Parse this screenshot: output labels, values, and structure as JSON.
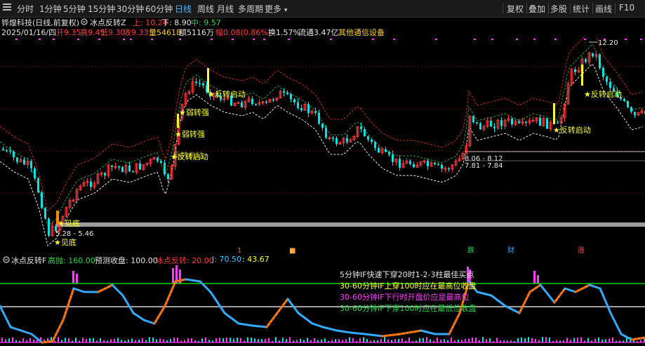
{
  "toolbar": {
    "left_items": [
      "分时",
      "1分钟",
      "5分钟",
      "15分钟",
      "30分钟",
      "60分钟",
      "日线",
      "周线",
      "月线",
      "多周期",
      "更多"
    ],
    "active_item": "日线",
    "right_items": [
      "复权",
      "叠加",
      "多股",
      "统计",
      "画线",
      "F10"
    ],
    "menu_icon": "hamburger-menu-icon"
  },
  "info_bar": {
    "stock": "铧煌科技(日线,前复权)",
    "indicator_icon": "circle-settings-icon",
    "indicator": "冰点反转Z",
    "up_label": "上: 10.24",
    "down_label": "下: 8.90",
    "mid_label": "中: 9.57"
  },
  "quote_bar": {
    "date": "2025/01/16/四",
    "open": "开9.35",
    "high": "高9.45",
    "low": "低9.30",
    "close": "收9.33",
    "volume": "量54618",
    "amount": "额5116万",
    "change": "幅0.08(0.86%)",
    "turnover": "换1.57%",
    "float_cap": "流通3.47亿",
    "sector": "其他通信设备"
  },
  "main_chart_labels": {
    "max_price": "12.20",
    "min_price": "5.28 - 5.46",
    "range1": "8.06 - 8.12",
    "range2": "7.81 - 7.84",
    "signals": [
      "见底",
      "见底",
      "弱转强",
      "弱转强",
      "反转启动",
      "反转启动",
      "反转启动",
      "反转启动",
      "反转启动"
    ],
    "event_markers": [
      "1",
      "跌",
      "财",
      "涨"
    ]
  },
  "indicator_bar": {
    "name": "冰点反转F",
    "high_throw": "高抛: 160.00",
    "forecast": "预测收盘: 100.00",
    "bingdian": "冰点反转: 20.00",
    "j_value": "J: 70.50",
    "val2": ": 43.67"
  },
  "legend": {
    "line1": "5分钟IF快速下穿20时1-2-3柱最佳买点",
    "line2": "30-60分钟IF上穿100时应在最高位收盘",
    "line3": "30-60分钟IF下行时开盘价应是最高位",
    "line4": "30-60分钟IF下穿100时应在最低位收盘"
  },
  "colors": {
    "up": "#ff3b3b",
    "down": "#00e5e5",
    "signal": "#ffff00",
    "upper_band": "#c0282c",
    "mid_band": "#1f9f3f",
    "lower_band": "#e8e8e8",
    "if_green": "#00ff00",
    "if_white": "#ffffff",
    "if_magenta": "#ff3cff"
  }
}
